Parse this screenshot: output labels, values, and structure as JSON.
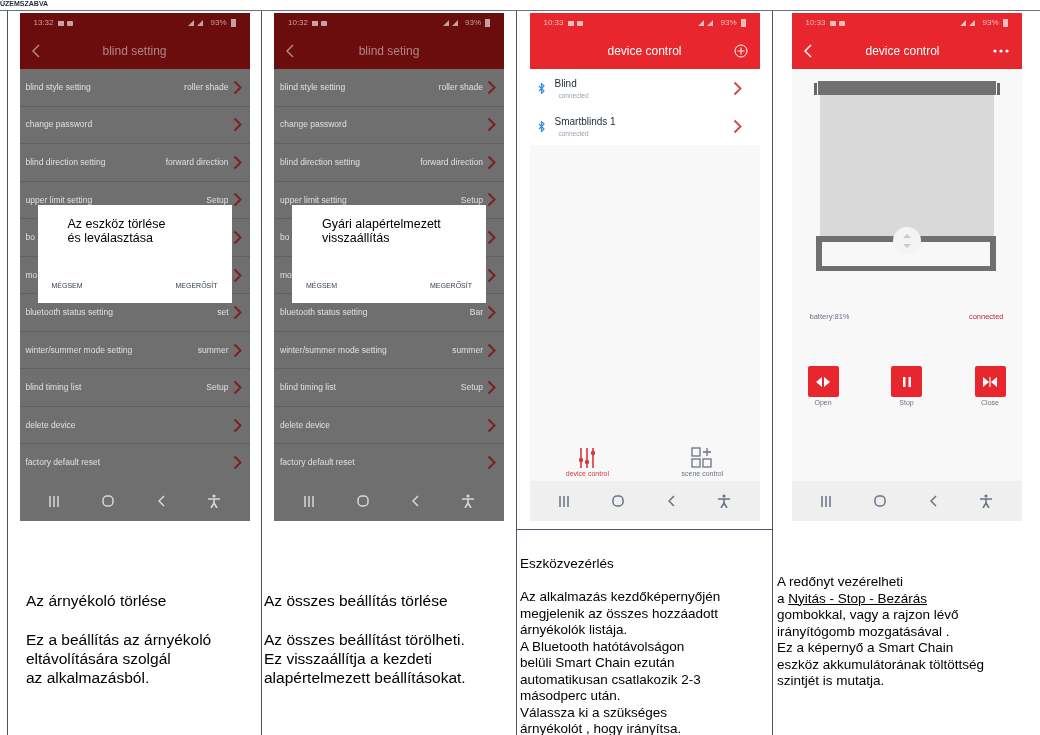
{
  "page_header": "ÚZEMSZABVA",
  "columns": [
    {
      "kind": "settings",
      "phone": {
        "time": "13:32",
        "battery": "93%",
        "title": "blind setting",
        "items": [
          {
            "label": "blind style setting",
            "value": "roller shade"
          },
          {
            "label": "change password"
          },
          {
            "label": "blind direction setting",
            "value": "forward direction"
          },
          {
            "label": "upper limit setting",
            "value": "Setup"
          },
          {
            "label": "bo"
          },
          {
            "label": "mo"
          },
          {
            "label": "bluetooth status setting",
            "value": "set"
          },
          {
            "label": "winter/summer mode setting",
            "value": "summer"
          },
          {
            "label": "blind timing list",
            "value": "Setup"
          },
          {
            "label": "delete device"
          },
          {
            "label": "factory default reset"
          }
        ],
        "dialog": {
          "message": "Az eszköz törlése\nés leválasztása",
          "buttons": [
            "MÉGSEM",
            "MEGERŐSÍT"
          ]
        }
      },
      "caption": {
        "title": "Az árnyékoló törlése",
        "body": "Ez a beállítás az árnyékoló\neltávolítására szolgál\naz alkalmazásból."
      }
    },
    {
      "kind": "settings",
      "phone": {
        "time": "10:32",
        "battery": "93%",
        "title": "blind seting",
        "items": [
          {
            "label": "blind style setting",
            "value": "roller shade"
          },
          {
            "label": "change password"
          },
          {
            "label": "blind direction setting",
            "value": "forward direction"
          },
          {
            "label": "upper limit setting",
            "value": "Setup"
          },
          {
            "label": "bo"
          },
          {
            "label": "mo"
          },
          {
            "label": "bluetooth status setting",
            "value": "Bar"
          },
          {
            "label": "winter/summer mode setting",
            "value": "summer"
          },
          {
            "label": "blind timing list",
            "value": "Setup"
          },
          {
            "label": "delete device"
          },
          {
            "label": "factory default reset"
          }
        ],
        "dialog": {
          "message": "Gyári alapértelmezett\nvisszaállítás",
          "buttons": [
            "MÉGSEM",
            "MEGERŐSÍT"
          ]
        }
      },
      "caption": {
        "title": "Az összes beállítás törlése",
        "body": "Az összes beállítást törölheti.\nEz visszaállítja a kezdeti\nalapértelmezett beállításokat."
      }
    },
    {
      "kind": "device_list",
      "phone": {
        "time": "10:33",
        "battery": "93%",
        "title": "device control",
        "devices": [
          {
            "name": "Blind",
            "status": "connected"
          },
          {
            "name": "Smartblinds 1",
            "status": "connected"
          }
        ],
        "tabs": [
          {
            "label": "device control",
            "selected": true
          },
          {
            "label": "scene control",
            "selected": false
          }
        ]
      },
      "caption": {
        "title": "Eszközvezérlés",
        "body": "Az alkalmazás kezdőképernyőjén\nmegjelenik az összes hozzáadott\nárnyékolók listája.\nA Bluetooth hatótávolságon\nbelüli Smart Chain ezután\nautomatikusan csatlakozik 2-3\nmásodperc után.\nVálassza ki a szükséges\nárnyékolót , hogy irányítsa."
      }
    },
    {
      "kind": "blind_control",
      "phone": {
        "time": "10:33",
        "battery": "93%",
        "title": "device control",
        "battery_reading": "battery:81%",
        "connection": "connected",
        "buttons": [
          {
            "kind": "open",
            "label": "Open"
          },
          {
            "kind": "stop",
            "label": "Stop"
          },
          {
            "kind": "close",
            "label": "Close"
          }
        ]
      },
      "caption": {
        "before": "A redőnyt vezérelheti\na ",
        "underlined": "Nyitás - Stop - Bezárás",
        "after": "\ngombokkal, vagy a rajzon lévő\nirányítógomb mozgatásával .\nEz a képernyő a Smart Chain\neszköz akkumulátorának töltöttség\nszintjét is mutatja."
      }
    }
  ]
}
